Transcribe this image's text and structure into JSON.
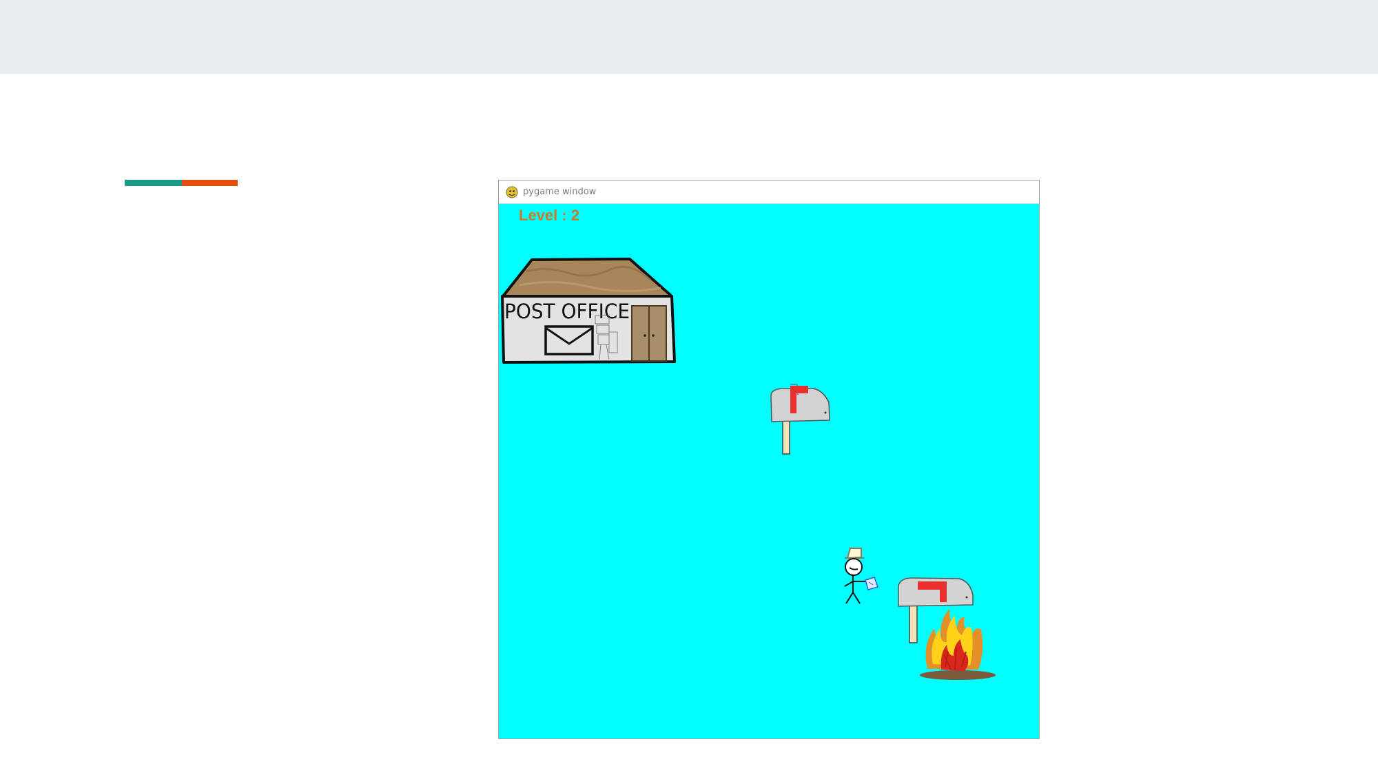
{
  "window": {
    "title": "pygame window",
    "icon": "pygame-snake-icon"
  },
  "hud": {
    "level_label": "Level :",
    "level_value": "2"
  },
  "scene": {
    "background_color": "#00ffff",
    "building": {
      "sign_text": "POST OFFICE",
      "icon": "envelope-icon"
    },
    "sprites": [
      "post-office",
      "mailbox-flag-up",
      "mailman-stickman",
      "burning-mailbox"
    ]
  },
  "colors": {
    "accent_teal": "#1a9a8a",
    "accent_orange": "#e5500f",
    "hud_text": "#c77a2a",
    "mailbox_flag": "#e8312c",
    "fire_yellow": "#ffd21a",
    "fire_orange": "#f08a1e",
    "fire_red": "#d8281c"
  }
}
